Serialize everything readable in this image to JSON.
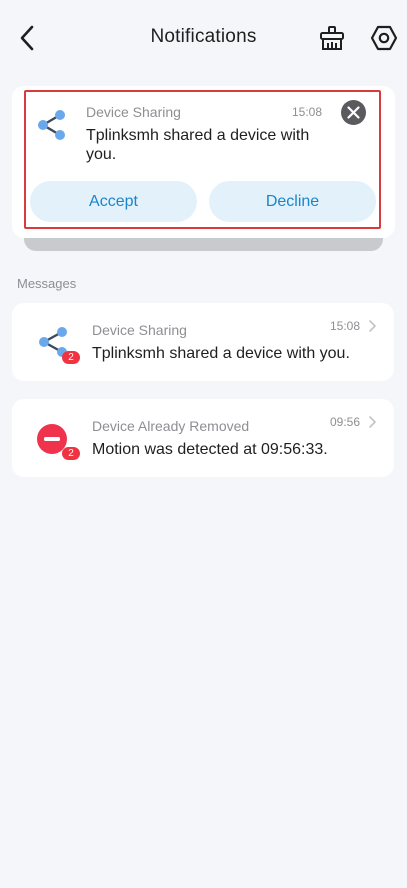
{
  "header": {
    "title": "Notifications",
    "back_icon": "chevron-left-icon",
    "clean_icon": "broom-icon",
    "settings_icon": "hexagon-gear-icon"
  },
  "pinned_request": {
    "category": "Device Sharing",
    "time": "15:08",
    "message": "Tplinksmh shared a device with you.",
    "accept_label": "Accept",
    "decline_label": "Decline",
    "icon": "share-icon"
  },
  "messages_section": {
    "title": "Messages",
    "items": [
      {
        "category": "Device Sharing",
        "time": "15:08",
        "text": "Tplinksmh shared a device with you.",
        "badge": "2",
        "icon": "share-icon"
      },
      {
        "category": "Device Already Removed",
        "time": "09:56",
        "text": "Motion was detected at 09:56:33.",
        "badge": "2",
        "icon": "removed-icon"
      }
    ]
  },
  "colors": {
    "accent_blue": "#1a86c9",
    "button_bg": "#e3f1fb",
    "badge_red": "#ef3340",
    "removed_red": "#f0334d",
    "share_blue": "#6aa8ec",
    "highlight_border": "#d93a3a"
  }
}
